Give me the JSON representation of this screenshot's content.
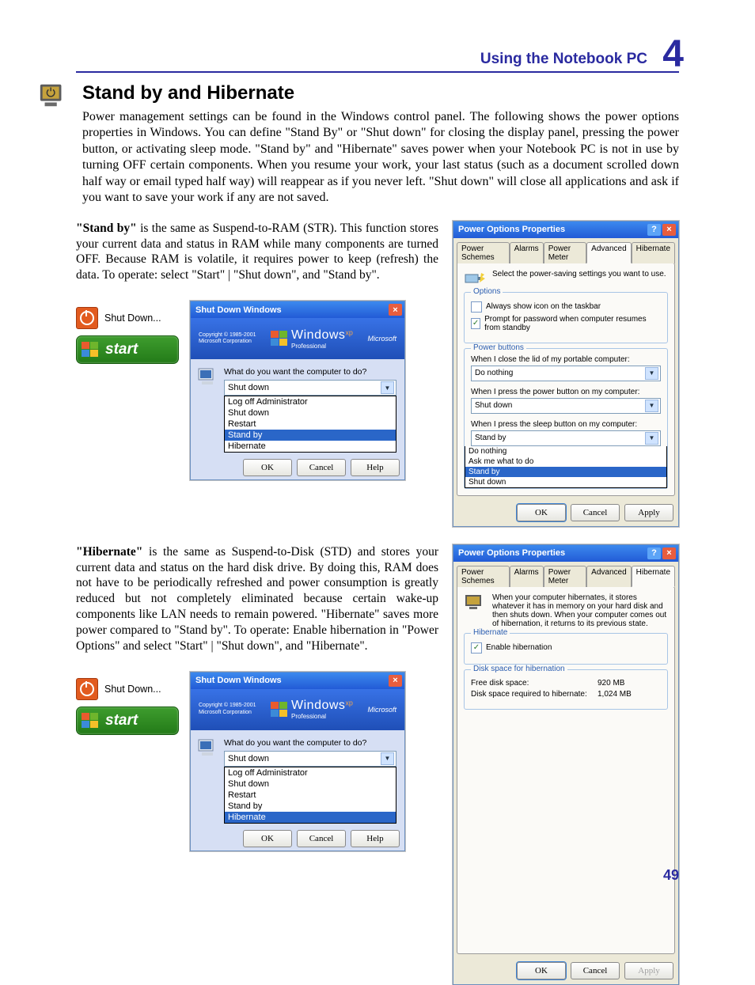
{
  "chapter": {
    "title": "Using the Notebook PC",
    "number": "4"
  },
  "h1": "Stand by and Hibernate",
  "intro": "Power management settings can be found in the Windows control panel. The following shows the power options properties in Windows. You can define \"Stand By\" or \"Shut down\" for closing the display panel, pressing the power button, or activating sleep mode. \"Stand by\" and \"Hibernate\" saves power when your Notebook PC is not in use by turning OFF certain components. When you resume your work, your last status (such as a document scrolled down half way or email typed half way) will reappear as if you never left. \"Shut down\" will close all applications and ask if you want to save your work if any are not saved.",
  "standby": {
    "label": "\"Stand by\"",
    "rest": " is the same as Suspend-to-RAM (STR). This function stores your current data and status in RAM while many components are turned OFF. Because RAM is volatile, it requires power to keep (refresh) the data. To operate: select \"Start\" | \"Shut down\", and \"Stand by\"."
  },
  "hibernate": {
    "label": "\"Hibernate\"",
    "rest": " is the same as  Suspend-to-Disk (STD) and stores your current data and status on the hard disk drive. By doing this, RAM does not have to be periodically refreshed and power consumption is greatly reduced but not completely eliminated because certain wake-up components like LAN needs to remain powered. \"Hibernate\" saves more power compared to \"Stand by\". To operate: Enable hibernation in \"Power Options\" and select \"Start\" | \"Shut down\", and \"Hibernate\"."
  },
  "shutdown_label": "Shut Down...",
  "start_label": "start",
  "sdw": {
    "title": "Shut Down Windows",
    "brand": "Windows",
    "brand_ed": "Professional",
    "brand_xp": "xp",
    "copy": "Copyright © 1985-2001\nMicrosoft Corporation",
    "ms": "Microsoft",
    "q": "What do you want the computer to do?",
    "value": "Shut down",
    "options": [
      "Log off Administrator",
      "Shut down",
      "Restart",
      "Stand by",
      "Hibernate"
    ],
    "sel1": "Stand by",
    "sel2": "Hibernate",
    "btn_ok": "OK",
    "btn_cancel": "Cancel",
    "btn_help": "Help"
  },
  "pop_adv": {
    "title": "Power Options Properties",
    "tabs": [
      "Power Schemes",
      "Alarms",
      "Power Meter",
      "Advanced",
      "Hibernate"
    ],
    "desc": "Select the power-saving settings you want to use.",
    "grp_options": "Options",
    "opt1": "Always show icon on the taskbar",
    "opt1_chk": false,
    "opt2": "Prompt for password when computer resumes from standby",
    "opt2_chk": true,
    "grp_pb": "Power buttons",
    "q_lid": "When I close the lid of my portable computer:",
    "v_lid": "Do nothing",
    "q_pwr": "When I press the power button on my computer:",
    "v_pwr": "Shut down",
    "q_slp": "When I press the sleep button on my computer:",
    "v_slp": "Stand by",
    "slp_opts": [
      "Do nothing",
      "Ask me what to do",
      "Stand by",
      "Shut down"
    ],
    "ok": "OK",
    "cancel": "Cancel",
    "apply": "Apply"
  },
  "pop_hib": {
    "title": "Power Options Properties",
    "tabs": [
      "Power Schemes",
      "Alarms",
      "Power Meter",
      "Advanced",
      "Hibernate"
    ],
    "desc": "When your computer hibernates, it stores whatever it has in memory on your hard disk and then shuts down. When your computer comes out of hibernation, it returns to its previous state.",
    "grp_h": "Hibernate",
    "enable": "Enable hibernation",
    "enable_chk": true,
    "grp_d": "Disk space for hibernation",
    "free_l": "Free disk space:",
    "free_v": "920 MB",
    "req_l": "Disk space required to hibernate:",
    "req_v": "1,024 MB",
    "ok": "OK",
    "cancel": "Cancel",
    "apply": "Apply"
  },
  "page_number": "49"
}
